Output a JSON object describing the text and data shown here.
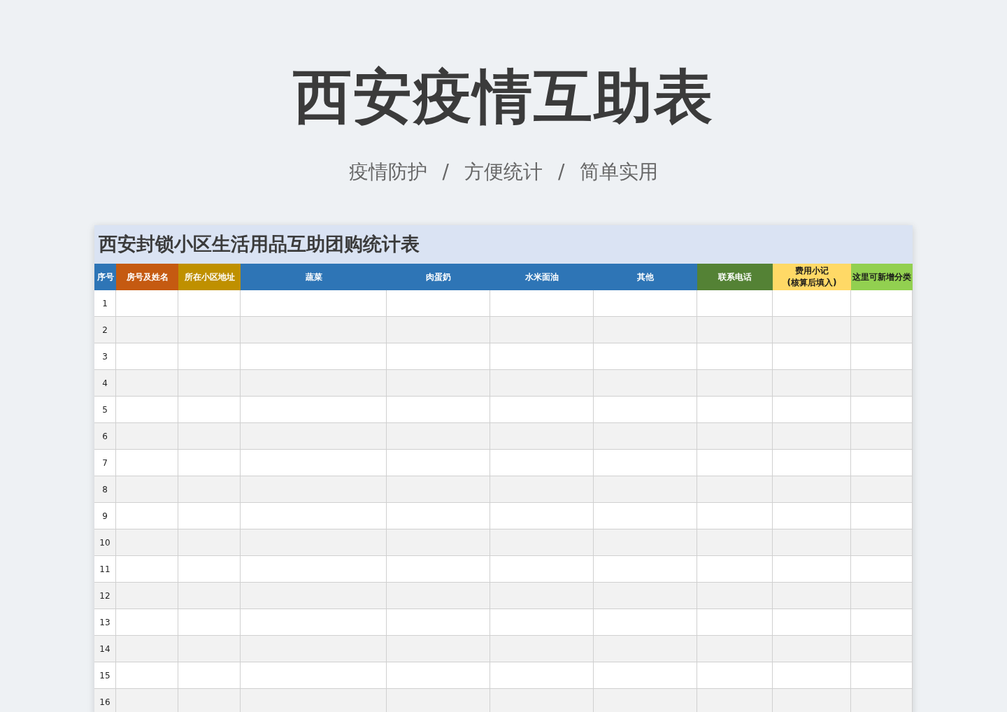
{
  "heading": "西安疫情互助表",
  "subtitle": [
    "疫情防护",
    "/",
    "方便统计",
    "/",
    "简单实用"
  ],
  "sheet": {
    "title": "西安封锁小区生活用品互助团购统计表",
    "columns": [
      {
        "label": "序号",
        "color": "#2e75b6"
      },
      {
        "label": "房号及姓名",
        "color": "#c55a11"
      },
      {
        "label": "所在小区地址",
        "color": "#bf9000"
      },
      {
        "label": "蔬菜",
        "color": "#2e75b6"
      },
      {
        "label": "肉蛋奶",
        "color": "#2e75b6"
      },
      {
        "label": "水米面油",
        "color": "#2e75b6"
      },
      {
        "label": "其他",
        "color": "#2e75b6"
      },
      {
        "label": "联系电话",
        "color": "#548235"
      },
      {
        "label": "费用小记\n(核算后填入)",
        "color": "#ffd966"
      },
      {
        "label": "这里可新增分类",
        "color": "#92d050"
      }
    ],
    "rows": [
      "1",
      "2",
      "3",
      "4",
      "5",
      "6",
      "7",
      "8",
      "9",
      "10",
      "11",
      "12",
      "13",
      "14",
      "15",
      "16"
    ]
  }
}
